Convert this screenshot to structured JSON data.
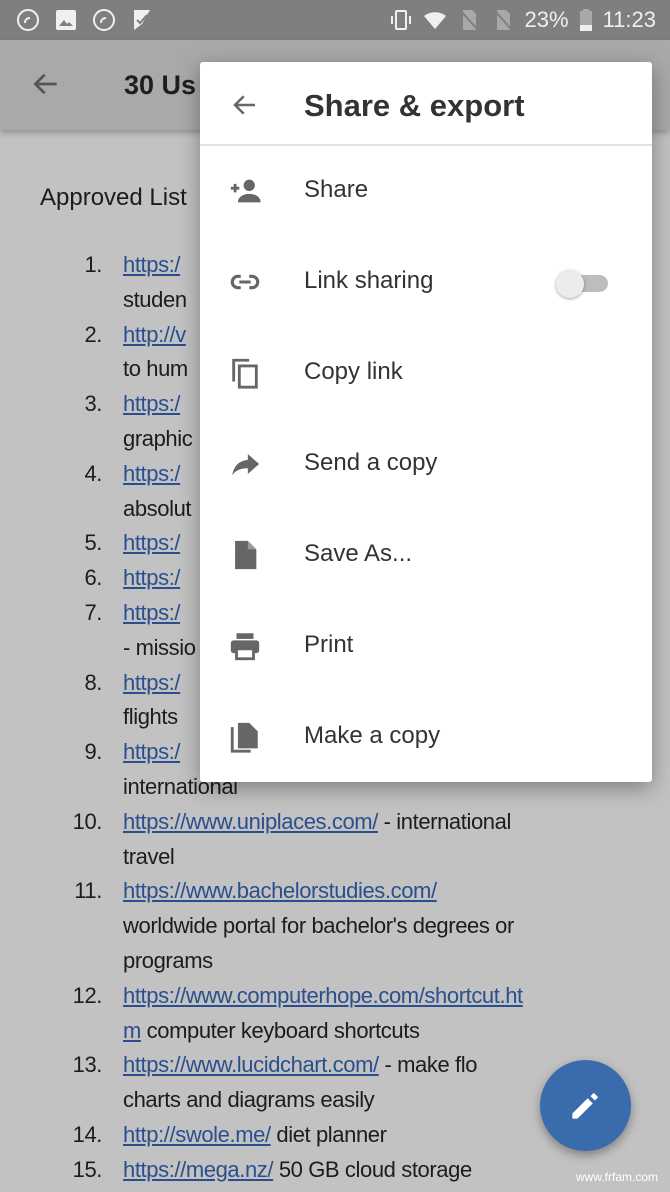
{
  "status_bar": {
    "battery": "23%",
    "time": "11:23",
    "icons": [
      "sync-icon",
      "image-icon",
      "sync-icon",
      "check-icon",
      "vibrate-icon",
      "wifi-icon",
      "no-sim-icon",
      "no-sim-icon",
      "battery-icon"
    ]
  },
  "app_bar": {
    "title": "30 Us"
  },
  "document": {
    "heading": "Approved List",
    "lines": [
      {
        "num": "1.",
        "link": "https:/",
        "text": ""
      },
      {
        "num": "",
        "link": "",
        "text": "studen"
      },
      {
        "num": "2.",
        "link": "http://v",
        "text": ""
      },
      {
        "num": "",
        "link": "",
        "text": "to hum"
      },
      {
        "num": "3.",
        "link": "https:/",
        "text": ""
      },
      {
        "num": "",
        "link": "",
        "text": "graphic"
      },
      {
        "num": "4.",
        "link": "https:/",
        "text": ""
      },
      {
        "num": "",
        "link": "",
        "text": "absolut"
      },
      {
        "num": "5.",
        "link": "https:/",
        "text": ""
      },
      {
        "num": "6.",
        "link": "https:/",
        "text": ""
      },
      {
        "num": "7.",
        "link": "https:/",
        "text": ""
      },
      {
        "num": "",
        "link": "",
        "text": "- missio"
      },
      {
        "num": "8.",
        "link": "https:/",
        "text": ""
      },
      {
        "num": "",
        "link": "",
        "text": "flights"
      },
      {
        "num": "9.",
        "link": "https:/",
        "text": ""
      },
      {
        "num": "",
        "link": "",
        "text": "international"
      },
      {
        "num": "10.",
        "link": "https://www.uniplaces.com/",
        "text": " - international"
      },
      {
        "num": "",
        "link": "",
        "text": "travel"
      },
      {
        "num": "11.",
        "link": "https://www.bachelorstudies.com/",
        "text": ""
      },
      {
        "num": "",
        "link": "",
        "text": "worldwide portal for bachelor's degrees or"
      },
      {
        "num": "",
        "link": "",
        "text": "programs"
      },
      {
        "num": "12.",
        "link": "https://www.computerhope.com/shortcut.ht",
        "text": ""
      },
      {
        "num": "",
        "link": "m",
        "text": " computer keyboard shortcuts"
      },
      {
        "num": "13.",
        "link": "https://www.lucidchart.com/",
        "text": " - make flo"
      },
      {
        "num": "",
        "link": "",
        "text": "charts and diagrams easily"
      },
      {
        "num": "14.",
        "link": "http://swole.me/",
        "text": " diet planner"
      },
      {
        "num": "15.",
        "link": "https://mega.nz/",
        "text": " 50 GB cloud storage"
      }
    ]
  },
  "menu": {
    "title": "Share & export",
    "items": [
      {
        "label": "Share",
        "icon": "person-add-icon"
      },
      {
        "label": "Link sharing",
        "icon": "link-icon",
        "toggle": false
      },
      {
        "label": "Copy link",
        "icon": "copy-icon"
      },
      {
        "label": "Send a copy",
        "icon": "forward-icon"
      },
      {
        "label": "Save As...",
        "icon": "file-icon"
      },
      {
        "label": "Print",
        "icon": "print-icon"
      },
      {
        "label": "Make a copy",
        "icon": "file-copy-icon"
      }
    ]
  },
  "fab": {
    "icon": "pencil-icon",
    "color": "#3a6cad"
  },
  "watermark": "www.frfam.com"
}
